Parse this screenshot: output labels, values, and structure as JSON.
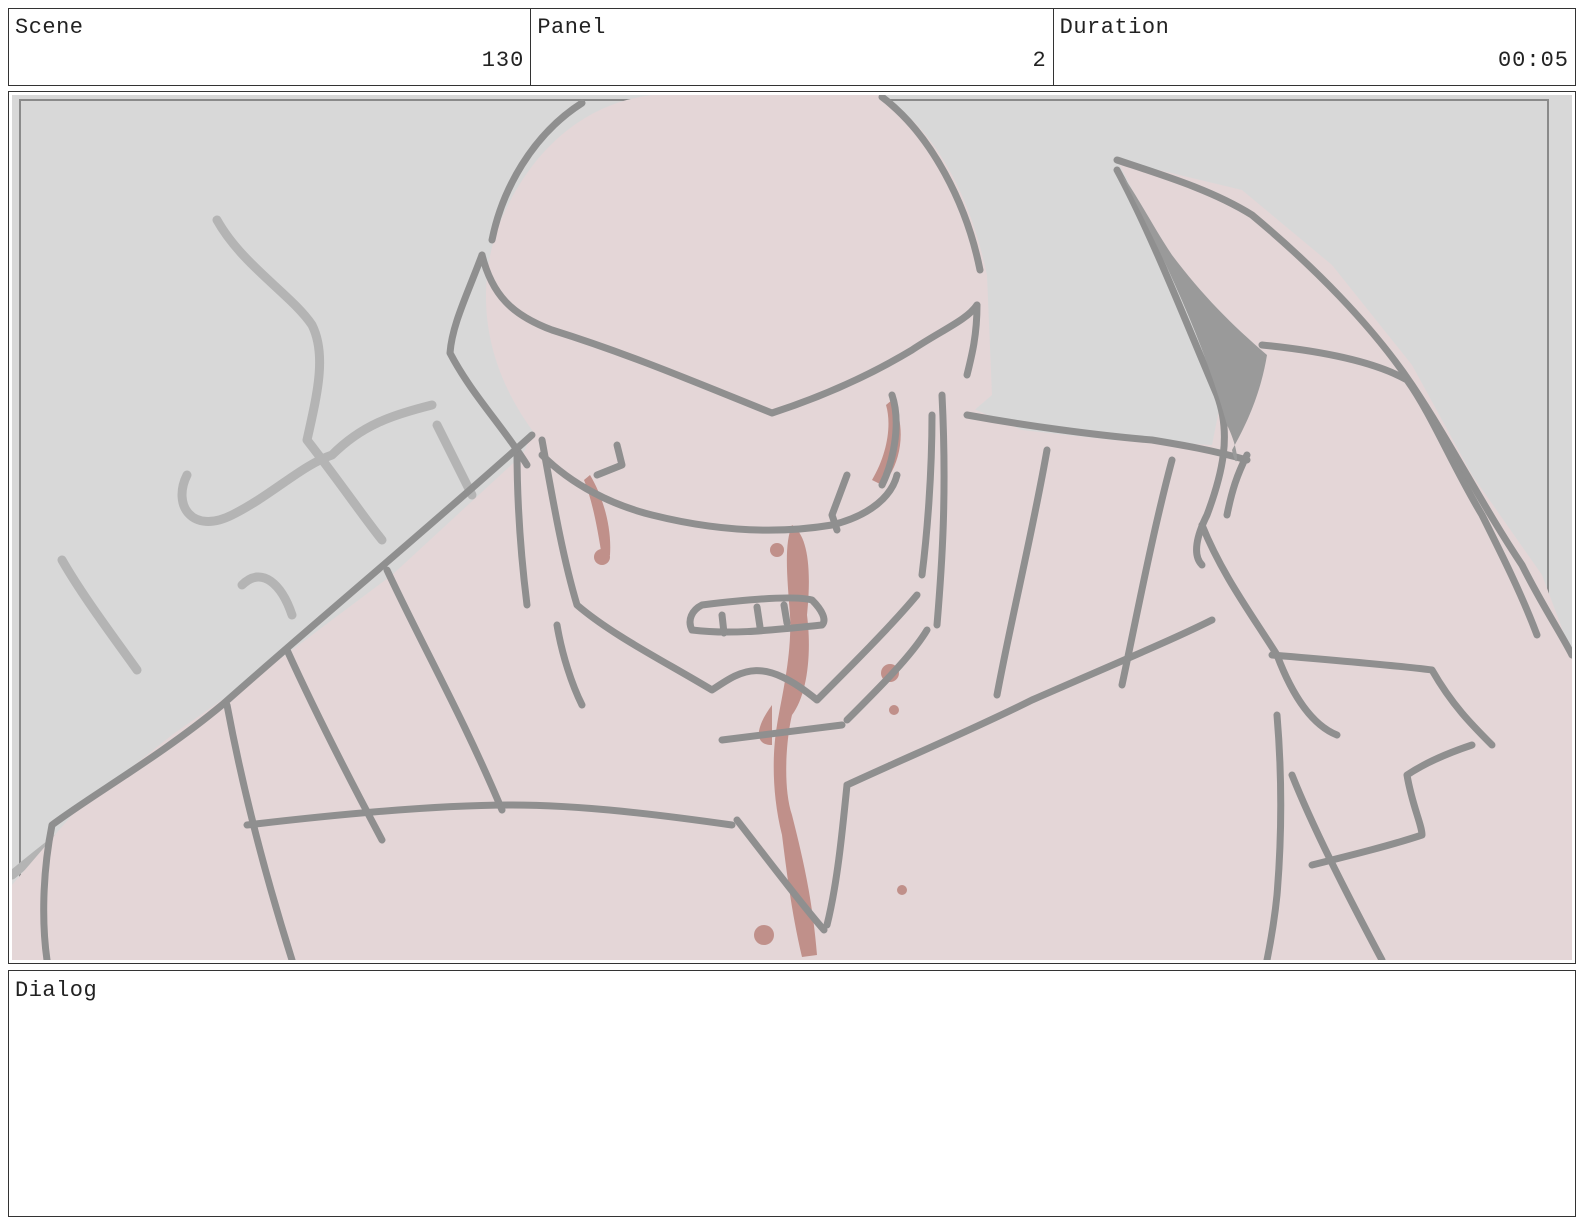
{
  "header": {
    "scene": {
      "label": "Scene",
      "value": "130"
    },
    "panel": {
      "label": "Panel",
      "value": "2"
    },
    "duration": {
      "label": "Duration",
      "value": "00:05"
    }
  },
  "artwork": {
    "icon": "storyboard-sketch",
    "colors": {
      "background": "#d8d8d8",
      "skin_fill": "#e4d6d7",
      "line": "#8f8f8f",
      "faint_line": "#b6b6b6",
      "blood": "#c0908a"
    }
  },
  "dialog": {
    "label": "Dialog",
    "text": ""
  }
}
